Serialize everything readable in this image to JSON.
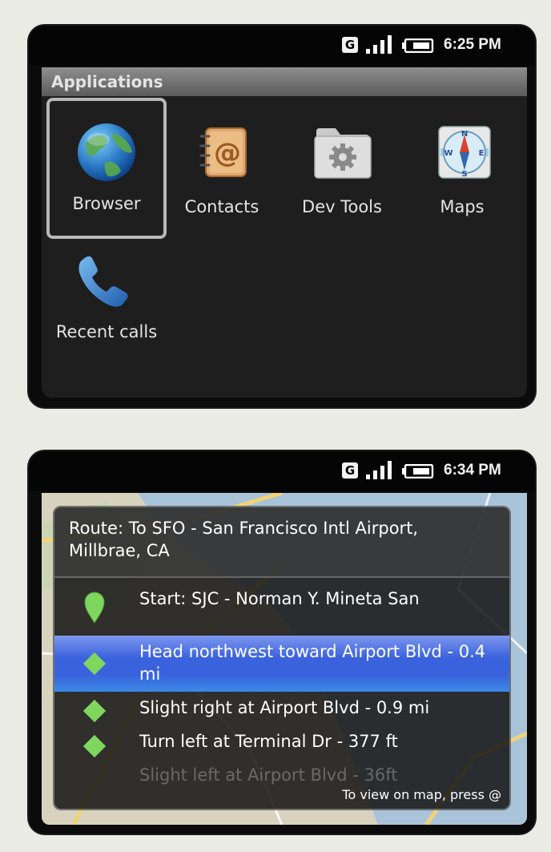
{
  "screen1": {
    "status": {
      "network": "G",
      "time": "6:25 PM"
    },
    "title": "Applications",
    "apps": [
      {
        "label": "Browser",
        "icon": "globe-icon",
        "selected": true
      },
      {
        "label": "Contacts",
        "icon": "address-book-icon",
        "selected": false
      },
      {
        "label": "Dev Tools",
        "icon": "gear-folder-icon",
        "selected": false
      },
      {
        "label": "Maps",
        "icon": "compass-icon",
        "selected": false
      },
      {
        "label": "Recent calls",
        "icon": "phone-handset-icon",
        "selected": false
      }
    ]
  },
  "screen2": {
    "status": {
      "network": "G",
      "time": "6:34 PM"
    },
    "route_title": "Route: To SFO - San Francisco Intl Airport, Millbrae, CA",
    "steps": [
      {
        "text": "Start: SJC - Norman Y. Mineta San",
        "icon": "map-pin-icon"
      },
      {
        "text": "Head northwest toward Airport Blvd - 0.4 mi",
        "icon": "diamond-icon",
        "highlighted": true
      },
      {
        "text": "Slight right at Airport Blvd - 0.9 mi",
        "icon": "diamond-icon"
      },
      {
        "text": "Turn left at Terminal Dr - 377 ft",
        "icon": "diamond-icon"
      },
      {
        "text": "Slight left at Airport Blvd - 36ft",
        "icon": "diamond-icon"
      }
    ],
    "hint": "To view on map, press @"
  },
  "colors": {
    "highlight": "#3a62dd",
    "pin": "#7ed65f",
    "status_bar": "#050505",
    "drawer": "#1e1e1e"
  }
}
